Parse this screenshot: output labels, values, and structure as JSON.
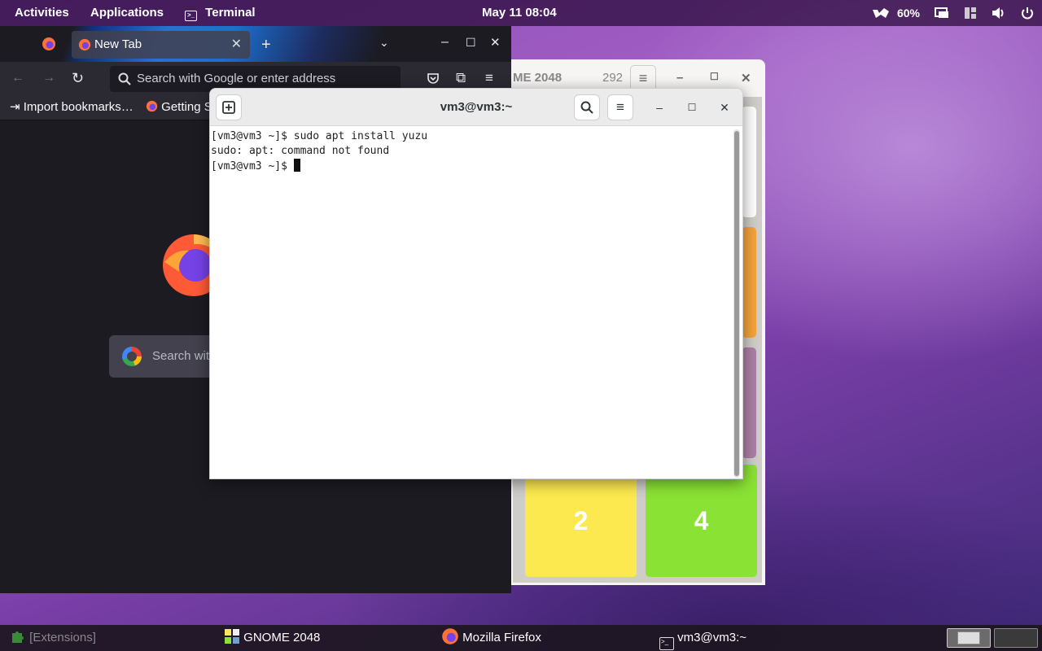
{
  "topbar": {
    "activities": "Activities",
    "applications": "Applications",
    "terminal_menu": "Terminal",
    "clock": "May 11  08:04",
    "battery": "60%"
  },
  "firefox": {
    "tab_title": "New Tab",
    "address_placeholder": "Search with Google or enter address",
    "bookmarks": [
      "Import bookmarks…",
      "Getting S"
    ],
    "search_placeholder": "Search wit"
  },
  "game2048": {
    "title": "ME 2048",
    "score": "292",
    "tiles": [
      "2",
      "4"
    ],
    "colors": {
      "tile2": "#fce94f",
      "tile4": "#8ae234",
      "orange": "#f6a33b",
      "purple": "#ad7fa8"
    }
  },
  "terminal": {
    "title": "vm3@vm3:~",
    "lines": [
      "[vm3@vm3 ~]$ sudo apt install yuzu",
      "sudo: apt: command not found"
    ],
    "prompt": "[vm3@vm3 ~]$ "
  },
  "taskbar": {
    "extensions": "[Extensions]",
    "game": "GNOME 2048",
    "firefox": "Mozilla Firefox",
    "terminal": "vm3@vm3:~"
  }
}
